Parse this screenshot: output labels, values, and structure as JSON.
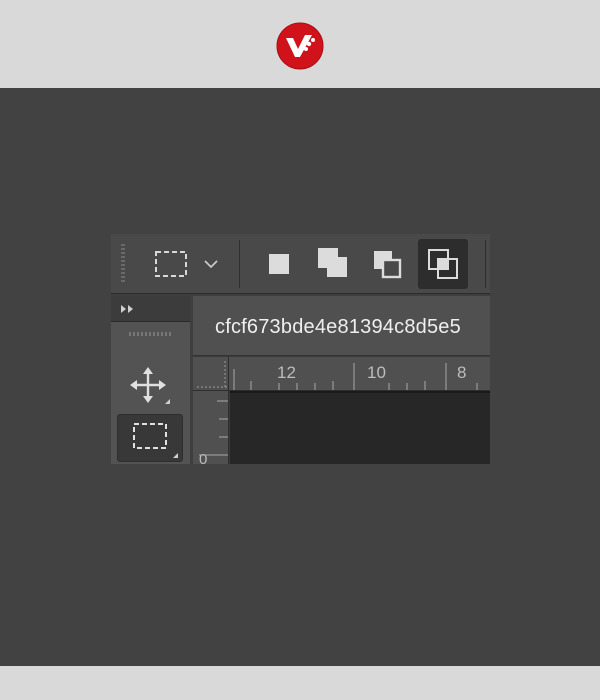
{
  "brand": {
    "icon": "brand-logo"
  },
  "document": {
    "title": "cfcf673bde4e81394c8d5e5"
  },
  "ruler": {
    "horizontal_labels": [
      "12",
      "10",
      "8"
    ],
    "vertical_labels": [
      "0"
    ]
  },
  "options_bar": {
    "marquee_tool_icon": "rectangular-marquee-icon",
    "dropdown_icon": "chevron-down-icon",
    "selection_modes": [
      "new-selection-icon",
      "add-to-selection-icon",
      "subtract-from-selection-icon",
      "intersect-selection-icon"
    ],
    "active_mode": "intersect-selection-icon"
  },
  "toolbar": {
    "tools": [
      "move-tool-icon",
      "rectangular-marquee-tool-icon"
    ],
    "active_tool": "rectangular-marquee-tool-icon"
  },
  "colors": {
    "accent": "#d0121a",
    "workspace": "#424242",
    "frame": "#d9d9d9"
  }
}
